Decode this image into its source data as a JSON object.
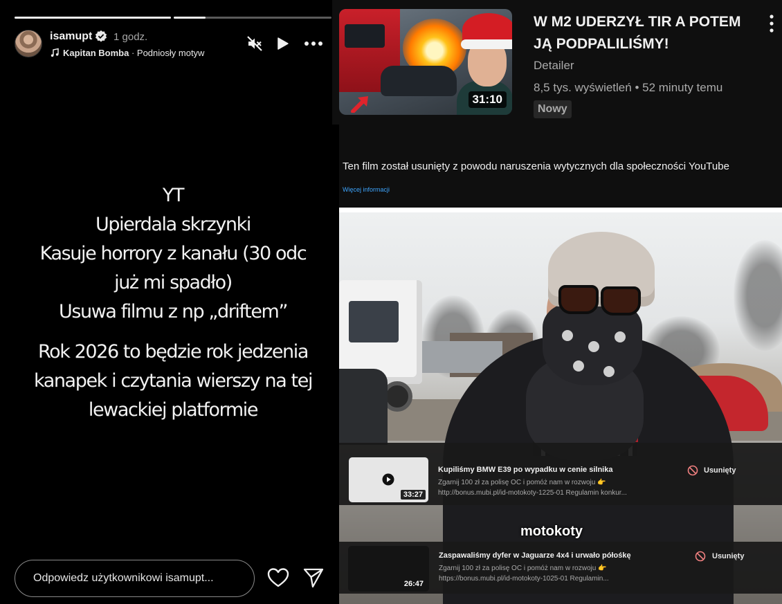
{
  "story": {
    "username": "isamupt",
    "time": "1 godz.",
    "music_artist": "Kapitan Bomba",
    "music_separator": " · ",
    "music_track": "Podniosły motyw",
    "text_lines": [
      "YT",
      "Upierdala skrzynki",
      "Kasuje horrory z kanału (30 odc",
      "już mi spadło)",
      "Usuwa filmu z np „driftem”",
      "",
      "Rok 2026 to będzie rok jedzenia",
      "kanapek i czytania wierszy na tej",
      "lewackiej platformie"
    ],
    "reply_placeholder": "Odpowiedz użytkownikowi isamupt...",
    "progress": [
      1.0,
      0.2
    ]
  },
  "youtube_card": {
    "title": "W M2 UDERZYŁ TIR A POTEM JĄ PODPALILIŚMY!",
    "channel": "Detailer",
    "meta": "8,5 tys. wyświetleń • 52 minuty temu",
    "badge": "Nowy",
    "duration": "31:10"
  },
  "removal_notice": {
    "text": "Ten film został usunięty z powodu naruszenia wytycznych dla społeczności YouTube",
    "link": "Więcej informacji"
  },
  "removed_videos": [
    {
      "title": "Kupiliśmy BMW E39 po wypadku w cenie silnika",
      "desc_line1": "Zgarnij 100 zł za polisę OC i pomóż nam w rozwoju 👉",
      "desc_line2": "http://bonus.mubi.pl/id-motokoty-1225-01 Regulamin konkur...",
      "duration": "33:27",
      "status": "Usunięty"
    },
    {
      "title": "Zaspawaliśmy dyfer w Jaguarze 4x4 i urwało półośkę",
      "desc_line1": "Zgarnij 100 zł za polisę OC i pomóż nam w rozwoju 👉",
      "desc_line2": "https://bonus.mubi.pl/id-motokoty-1025-01 Regulamin...",
      "duration": "26:47",
      "status": "Usunięty"
    }
  ],
  "photo_overlay_text": "motokoty",
  "colors": {
    "story_bg": "#000000",
    "yt_bg": "#0f0f0f",
    "yt_link": "#3ea6ff"
  },
  "icons": [
    "verified-badge-icon",
    "music-note-icon",
    "mute-icon",
    "play-icon",
    "more-icon",
    "heart-icon",
    "send-icon",
    "kebab-menu-icon",
    "play-circle-icon",
    "ban-icon"
  ]
}
